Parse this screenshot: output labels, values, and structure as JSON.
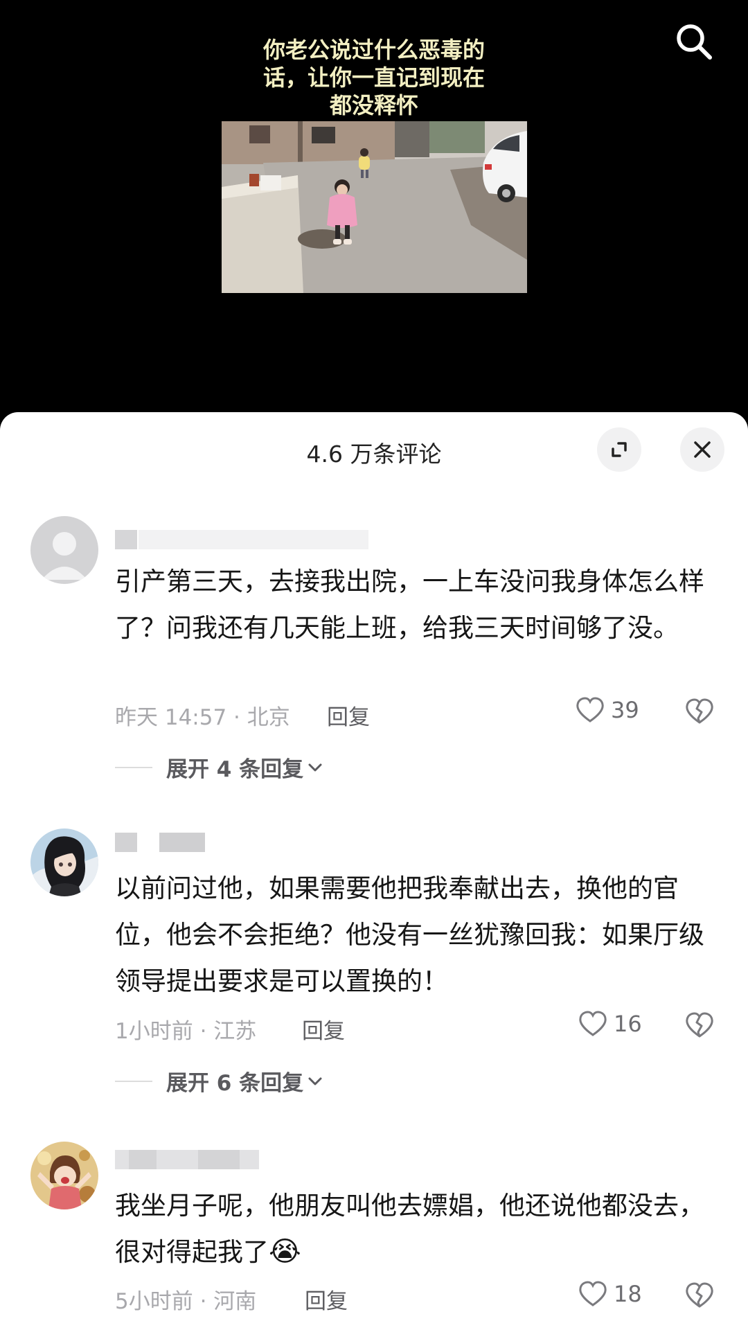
{
  "video": {
    "caption_lines": [
      "你老公说过什么恶毒的",
      "话，让你一直记到现在",
      "都没释怀"
    ]
  },
  "sheet": {
    "title": "4.6 万条评论"
  },
  "comments": [
    {
      "text": "引产第三天，去接我出院，一上车没问我身体怎么样了？问我还有几天能上班，给我三天时间够了没。",
      "time_location": "昨天 14:57 · 北京",
      "reply_label": "回复",
      "likes": "39",
      "expand_label": "展开 4 条回复"
    },
    {
      "text": "以前问过他，如果需要他把我奉献出去，换他的官位，他会不会拒绝？他没有一丝犹豫回我：如果厅级领导提出要求是可以置换的！",
      "time_location": "1小时前 · 江苏",
      "reply_label": "回复",
      "likes": "16",
      "expand_label": "展开 6 条回复"
    },
    {
      "text": "我坐月子呢，他朋友叫他去嫖娼，他还说他都没去，很对得起我了",
      "emoji": "😭",
      "time_location": "5小时前 · 河南",
      "reply_label": "回复",
      "likes": "18"
    }
  ],
  "colors": {
    "caption": "#f3efc2",
    "sheet_bg": "#ffffff",
    "meta": "#a8a8ac"
  }
}
